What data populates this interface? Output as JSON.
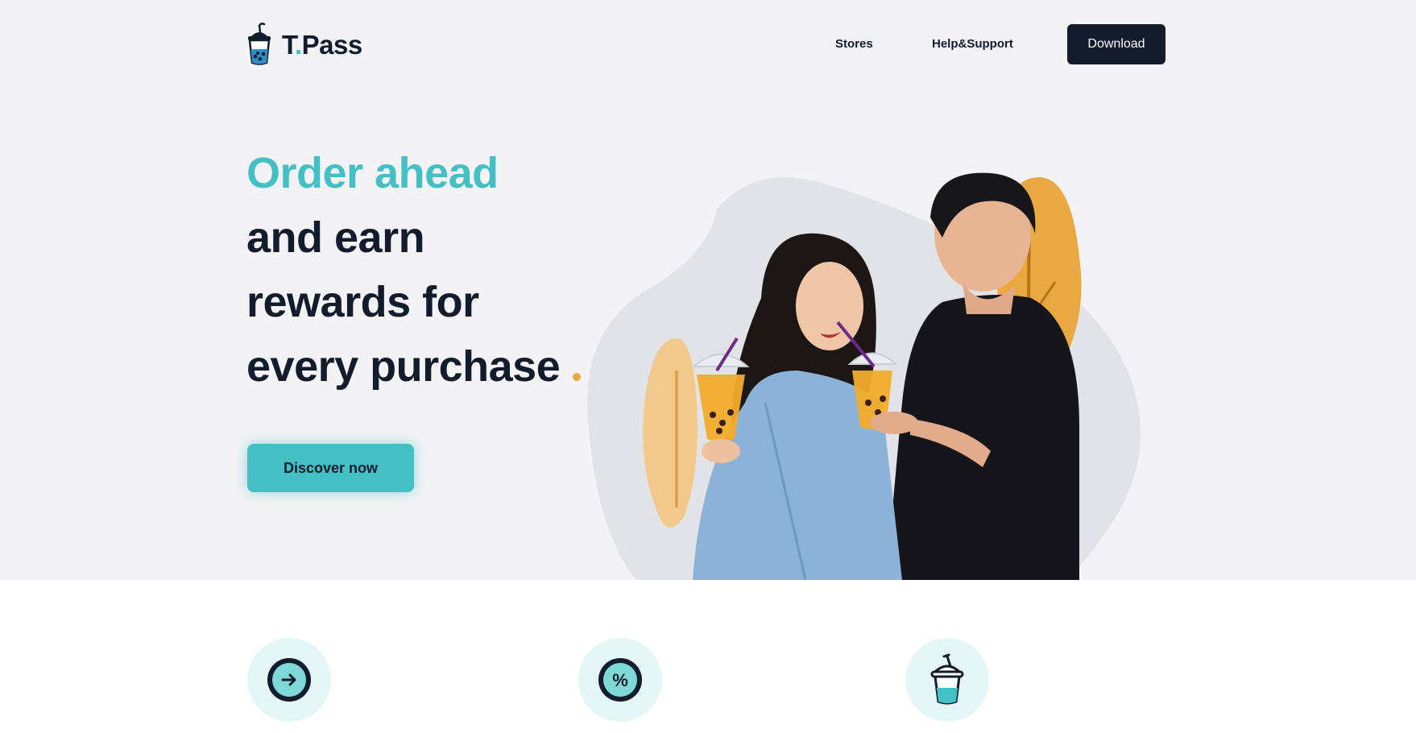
{
  "brand": {
    "name_prefix": "T",
    "name_dot": ".",
    "name_suffix": "Pass",
    "icon": "bubble-tea-cup-icon"
  },
  "nav": {
    "stores": "Stores",
    "help": "Help&Support",
    "download": "Download"
  },
  "hero": {
    "headline_line1": "Order ahead",
    "headline_line2": "and earn",
    "headline_line3": "rewards for",
    "headline_line4": "every purchase",
    "cta": "Discover now",
    "image": "couple-drinking-bubble-tea-illustration"
  },
  "features": [
    {
      "icon": "arrow-right-circle-icon"
    },
    {
      "icon": "percent-circle-icon"
    },
    {
      "icon": "bubble-tea-cup-icon"
    }
  ],
  "colors": {
    "teal": "#44c0c4",
    "navy": "#121c2d",
    "orange": "#e9a840",
    "hero_bg": "#f3f3f5"
  }
}
